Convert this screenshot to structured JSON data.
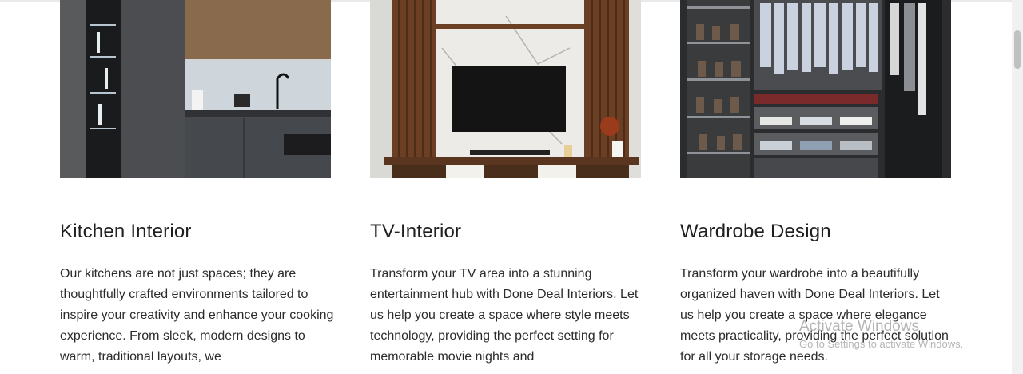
{
  "cards": [
    {
      "title": "Kitchen Interior",
      "description": "Our kitchens are not just spaces; they are thoughtfully crafted environments tailored to inspire your creativity and enhance your cooking experience. From sleek, modern designs to warm, traditional layouts, we",
      "image_subject": "modern dark kitchen with glass cabinet and wooden upper cabinets"
    },
    {
      "title": "TV-Interior",
      "description": "Transform your TV area into a stunning entertainment hub with Done Deal Interiors. Let us help you create a space where style meets technology, providing the perfect setting for memorable movie nights and",
      "image_subject": "TV unit with marble panel and wooden fluted side panels"
    },
    {
      "title": "Wardrobe Design",
      "description": "Transform your wardrobe into a beautifully organized haven with Done Deal Interiors. Let us help you create a space where elegance meets practicality, providing the perfect solution for all your storage needs.",
      "image_subject": "open wardrobe with shoe racks, hanging clothes and drawers"
    }
  ],
  "watermark": {
    "title": "Activate Windows",
    "subtitle": "Go to Settings to activate Windows."
  },
  "colors": {
    "text": "#222222",
    "background": "#ffffff"
  }
}
